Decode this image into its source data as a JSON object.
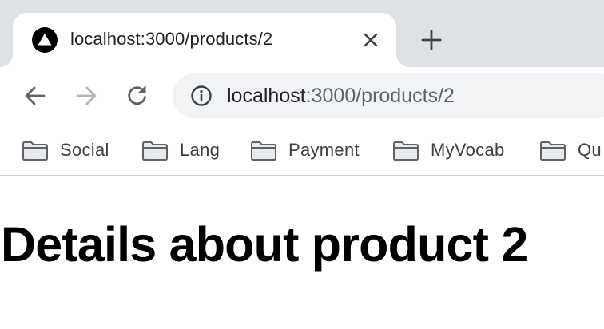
{
  "tab": {
    "title": "localhost:3000/products/2",
    "favicon": "triangle-logo-icon"
  },
  "toolbar": {
    "back_icon": "arrow-left-icon",
    "forward_icon": "arrow-right-icon",
    "reload_icon": "reload-icon",
    "url_host": "localhost",
    "url_rest": ":3000/products/2",
    "site_info_icon": "info-icon"
  },
  "bookmarks": [
    {
      "label": "Social",
      "icon": "folder-icon"
    },
    {
      "label": "Lang",
      "icon": "folder-icon"
    },
    {
      "label": "Payment",
      "icon": "folder-icon"
    },
    {
      "label": "MyVocab",
      "icon": "folder-icon"
    },
    {
      "label": "Qu",
      "icon": "folder-icon"
    }
  ],
  "page": {
    "heading": "Details about product 2"
  },
  "colors": {
    "tabstrip": "#dee1e6",
    "omnibox": "#f1f3f4",
    "text_primary": "#202124",
    "text_secondary": "#5f6368",
    "forward_disabled": "#b0b3b8"
  }
}
